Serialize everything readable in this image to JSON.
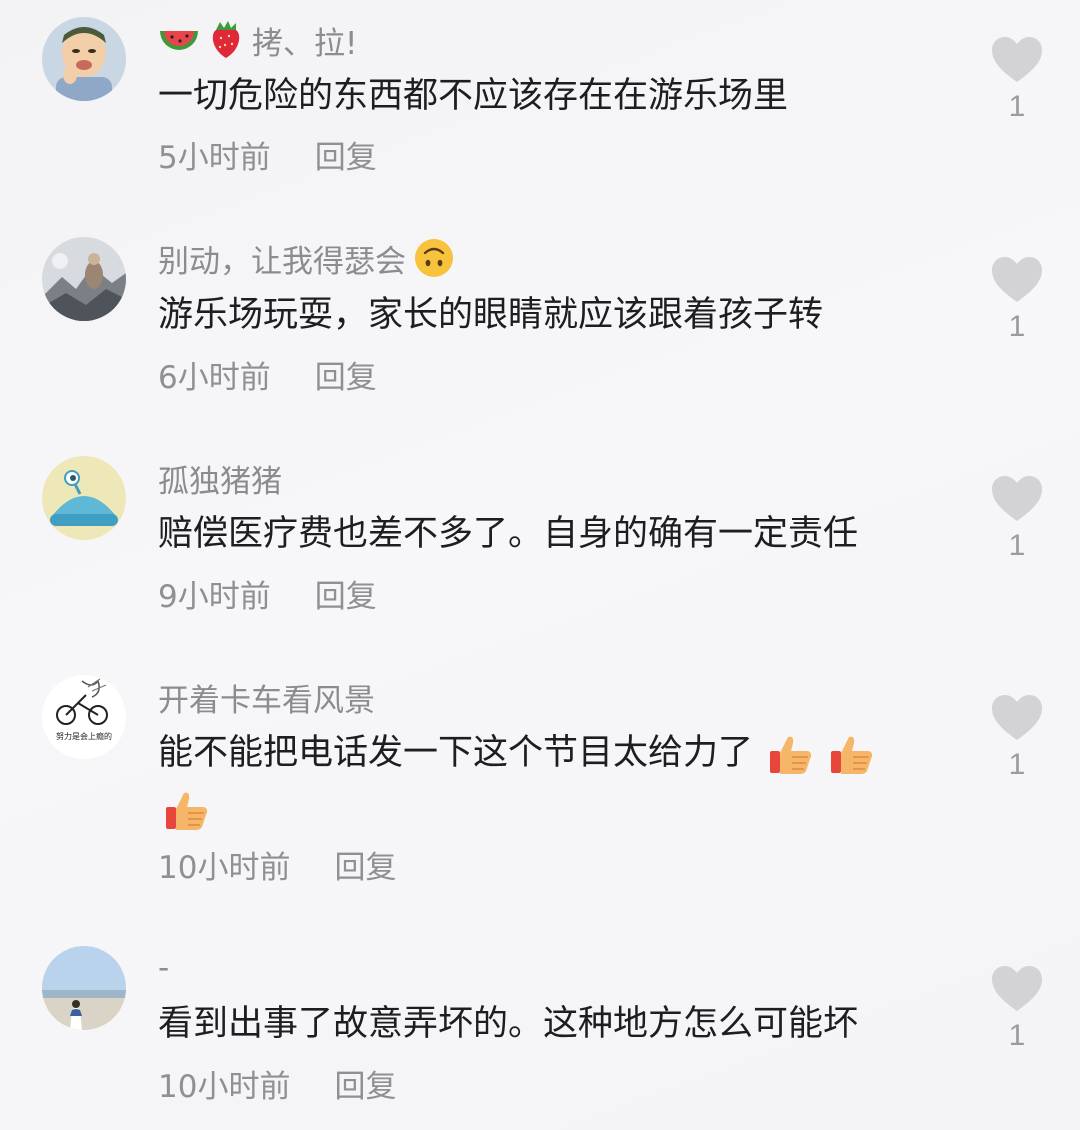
{
  "comments": [
    {
      "username": "拷、拉!",
      "username_emojis": [
        "watermelon-emoji",
        "strawberry-emoji"
      ],
      "text": "一切危险的东西都不应该存在在游乐场里",
      "time": "5小时前",
      "reply": "回复",
      "likes": "1"
    },
    {
      "username": "别动，让我得瑟会",
      "username_emojis_after": [
        "upside-down-face-emoji"
      ],
      "text": "游乐场玩耍，家长的眼睛就应该跟着孩子转",
      "time": "6小时前",
      "reply": "回复",
      "likes": "1"
    },
    {
      "username": "孤独猪猪",
      "text": "赔偿医疗费也差不多了。自身的确有一定责任",
      "time": "9小时前",
      "reply": "回复",
      "likes": "1"
    },
    {
      "username": "开着卡车看风景",
      "text": "能不能把电话发一下这个节目太给力了",
      "text_emojis": [
        "thumbs-up-emoji",
        "thumbs-up-emoji",
        "thumbs-up-emoji"
      ],
      "time": "10小时前",
      "reply": "回复",
      "likes": "1"
    },
    {
      "username": "-",
      "text": "看到出事了故意弄坏的。这种地方怎么可能坏",
      "time": "10小时前",
      "reply": "回复",
      "likes": "1"
    }
  ],
  "avatar_3_text": "努力是会上瘾的",
  "colors": {
    "username": "#8b8b90",
    "text": "#1e1e20",
    "meta": "#8f8f94",
    "heart": "#d3d3d6"
  }
}
